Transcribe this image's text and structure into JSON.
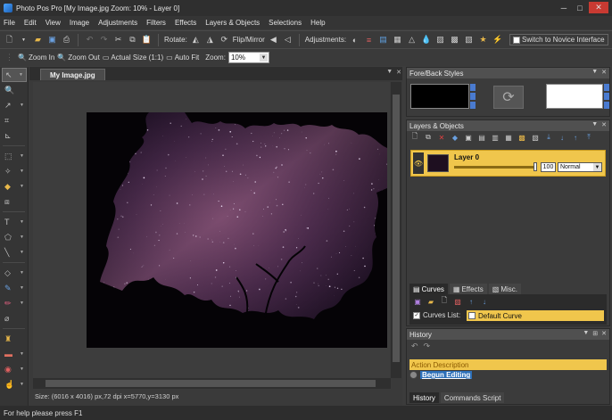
{
  "window": {
    "title": "Photo Pos Pro [My Image.jpg Zoom: 10% - Layer 0]"
  },
  "menu": [
    "File",
    "Edit",
    "View",
    "Image",
    "Adjustments",
    "Filters",
    "Effects",
    "Layers & Objects",
    "Selections",
    "Help"
  ],
  "toolbar": {
    "rotate_label": "Rotate:",
    "flip_mirror_label": "Flip/Mirror",
    "adjustments_label": "Adjustments:",
    "novice_label": "Switch to Novice Interface"
  },
  "zoombar": {
    "zoom_in": "Zoom In",
    "zoom_out": "Zoom Out",
    "actual_size": "Actual Size (1:1)",
    "auto_fit": "Auto Fit",
    "zoom_label": "Zoom:",
    "zoom_value": "10%"
  },
  "document": {
    "tab": "My Image.jpg",
    "status": "Size: (6016 x 4016) px,72 dpi   x=5770,y=3130 px"
  },
  "panels": {
    "fore_back": {
      "title": "Fore/Back Styles"
    },
    "layers": {
      "title": "Layers & Objects",
      "layer_name": "Layer 0",
      "opacity": "100",
      "blend_mode": "Normal",
      "tabs": [
        "Curves",
        "Effects",
        "Misc."
      ],
      "curves_list_label": "Curves List:",
      "curves_list_value": "Default Curve"
    },
    "history": {
      "title": "History",
      "header": "Action Description",
      "item": "Begun Editing",
      "tabs": [
        "History",
        "Commands Script"
      ]
    }
  },
  "statusbar": {
    "text": "For help please press F1"
  },
  "colors": {
    "accent": "#f0c64c",
    "selection_blue": "#2c6fb8"
  }
}
